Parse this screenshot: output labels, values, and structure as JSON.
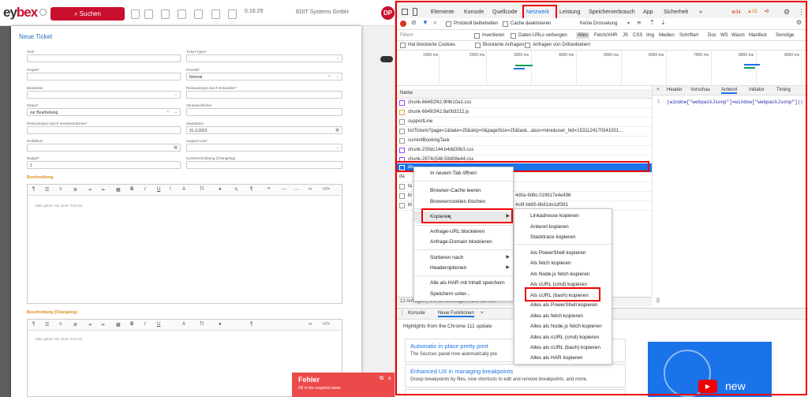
{
  "app": {
    "logo_prefix": "ey",
    "logo_suffix": "bex",
    "search_button": "Suchen",
    "clock": "0:16:29",
    "company": "EDIT Systems GmbH",
    "avatar": "DP",
    "modal_title": "Neue Ticket",
    "fields": {
      "text": "Text*",
      "ticket_type": "Ticket Typer*",
      "projekt": "Projekt*",
      "prioritaet": "Priorität*",
      "prioritaet_value": "Normal",
      "bearbeiter": "Bearbeiter",
      "risikoanalyse_entwickler": "Risikoanalyse durch Entwickler*",
      "status": "Status*",
      "status_value": "zur Bearbeitung",
      "verantwortlicher": "Verantwortlicher",
      "risikoanalyse_verantwortlicher": "Risikoanalyse durch Verantwortlichen*",
      "startdatum": "Startdatum",
      "startdatum_value": "31.3.2023",
      "enddatum": "Enddatum",
      "support_line": "Support Line*",
      "budget": "Budget*",
      "budget_value": "1",
      "kurzbeschreibung": "Kurzbeschreibung (Changelog)"
    },
    "beschreibung_label": "Beschreibung",
    "editor_placeholder1": "Bitte geben Sie einen Text ein",
    "beschreibung_changelog_label": "Beschreibung (Changelog)",
    "editor_placeholder2": "Bitte geben Sie einen Text ein",
    "toast": {
      "title": "Fehler",
      "message": "Fill in the required name"
    }
  },
  "devtools": {
    "tabs": [
      "Elemente",
      "Konsole",
      "Quellcode",
      "Netzwerk",
      "Leistung",
      "Speicherverbrauch",
      "App",
      "Sicherheit",
      "»"
    ],
    "badges": {
      "errors": "34",
      "warnings": "15",
      "issues": "6"
    },
    "toolbar": {
      "preserve_log": "Protokoll beibehalten",
      "disable_cache": "Cache deaktivieren",
      "throttle": "Keine Drosselung"
    },
    "filter": {
      "placeholder": "Filtern",
      "invert": "Invertieren",
      "hide_data_urls": "Daten-URLs verbergen",
      "types": [
        "Alles",
        "Fetch/XHR",
        "JS",
        "CSS",
        "Img",
        "Medien",
        "Schriftart",
        "Doc",
        "WS",
        "Wasm",
        "Manifest",
        "Sonstige"
      ],
      "blocked_cookies": "Hat blockierte Cookies",
      "blocked_requests": "Blockierte Anfragen",
      "third_party": "Anfragen von Drittanbietern"
    },
    "timeline_ticks": [
      "1000 ms",
      "2000 ms",
      "3000 ms",
      "4000 ms",
      "5000 ms",
      "6000 ms",
      "7000 ms",
      "8000 ms",
      "9000 ms"
    ],
    "name_header": "Name",
    "requests": [
      "chunk-66492f42.9f4b10a3.css",
      "chunk-66492f42.8a0b3212.js",
      "supportLine",
      "listTickets?page=1&take=25&skip=0&pageSize=25&task...atus=mine&user_hid=1531124170341001...",
      "currentBookingTask",
      "chunk-230dc144.b4dd30b3.css",
      "chunk-2874c546.59d08e44.css",
      "de",
      "da",
      "ta",
      "bl",
      "bl"
    ],
    "request_suffixes": {
      "r10": "4d0a-9d9c-019617e4e496",
      "r11": "4c6f-bb85-8b81de1df381"
    },
    "right_tabs": [
      "×",
      "Header",
      "Vorschau",
      "Antwort",
      "Initiator",
      "Timing"
    ],
    "response_line_no": "1",
    "response_text": "(window[\"webpackJsonp\"]=window[\"webpackJsonp\"]||",
    "status_bar": "12 Anfragen | 5.0 kB übertragen | 161 kB Res",
    "pretty_print": "{}",
    "drawer_tabs": [
      "Konsole",
      "Neue Funktionen",
      "×"
    ],
    "drawer_heading": "Highlights from the Chrome 111 update",
    "cards": [
      {
        "title": "Automatic in place pretty print",
        "desc": "The Sources panel now automatically pre"
      },
      {
        "title": "Enhanced UX in managing breakpoints",
        "desc": "Group breakpoints by files, new shortcuts to edit and remove breakpoints, and more."
      },
      {
        "title": "",
        "desc": ""
      }
    ],
    "yt_label": "new",
    "context_menu": [
      "In neuem Tab öffnen",
      "Browser-Cache leeren",
      "Browsercookies löschen",
      "Kopieren",
      "Anfrage-URL blockieren",
      "Anfrage-Domain blockieren",
      "Sortieren nach",
      "Headeroptionen",
      "Alle als HAR mit Inhalt speichern",
      "Speichern unter..."
    ],
    "copy_submenu": [
      "Linkadresse kopieren",
      "Antwort kopieren",
      "Stacktrace kopieren",
      "Als PowerShell kopieren",
      "Als fetch kopieren",
      "Als Node.js fetch kopieren",
      "Als cURL (cmd) kopieren",
      "Als cURL (bash) kopieren",
      "Alles als PowerShell kopieren",
      "Alles als fetch kopieren",
      "Alles als Node.js fetch kopieren",
      "Alles als cURL (cmd) kopieren",
      "Alles als cURL (bash) kopieren",
      "Alles als HAR kopieren"
    ]
  },
  "colors": {
    "brand_red": "#c8102e",
    "devtools_blue": "#1a73e8",
    "highlight_red": "#e00000",
    "toast_red": "#ec4a4a"
  }
}
